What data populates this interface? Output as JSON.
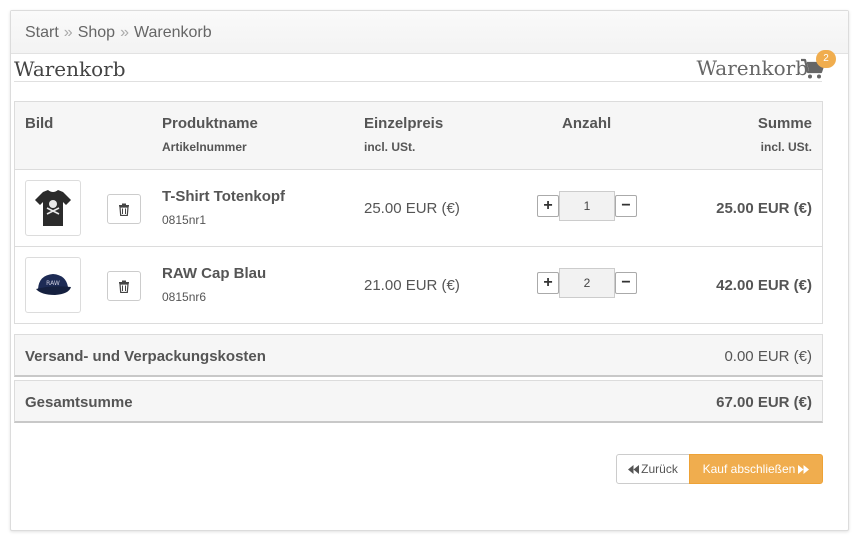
{
  "breadcrumb": {
    "items": [
      "Start",
      "Shop",
      "Warenkorb"
    ],
    "separator": "»"
  },
  "heading": {
    "title": "Warenkorb",
    "cart_link_label": "Warenkorb",
    "cart_count": "2"
  },
  "table": {
    "headers": {
      "image": "Bild",
      "product_name": "Produktname",
      "article_number": "Artikelnummer",
      "unit_price": "Einzelpreis",
      "unit_price_sub": "incl. USt.",
      "quantity": "Anzahl",
      "total": "Summe",
      "total_sub": "incl. USt."
    },
    "rows": [
      {
        "name": "T-Shirt Totenkopf",
        "article_number": "0815nr1",
        "unit_price": "25.00 EUR (€)",
        "quantity": "1",
        "total": "25.00 EUR (€)",
        "image_icon": "tshirt-image"
      },
      {
        "name": "RAW Cap Blau",
        "article_number": "0815nr6",
        "unit_price": "21.00 EUR (€)",
        "quantity": "2",
        "total": "42.00 EUR (€)",
        "image_icon": "cap-image"
      }
    ]
  },
  "shipping": {
    "label": "Versand- und Verpackungskosten",
    "value": "0.00 EUR (€)"
  },
  "grand_total": {
    "label": "Gesamtsumme",
    "value": "67.00 EUR (€)"
  },
  "buttons": {
    "back_label": "Zurück",
    "checkout_label": "Kauf abschließen"
  },
  "colors": {
    "accent": "#f0ad4e",
    "text": "#555555",
    "border": "#dcdcdc"
  }
}
